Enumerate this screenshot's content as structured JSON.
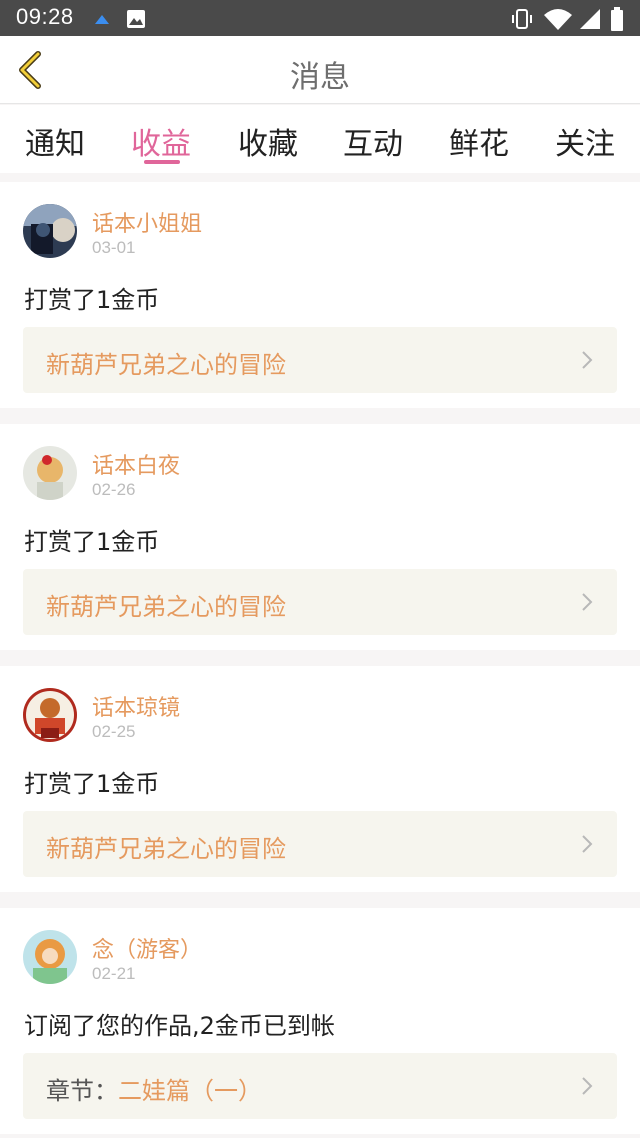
{
  "status_bar": {
    "time": "09:28"
  },
  "header": {
    "title": "消息"
  },
  "tabs": [
    {
      "label": "通知"
    },
    {
      "label": "收益"
    },
    {
      "label": "收藏"
    },
    {
      "label": "互动"
    },
    {
      "label": "鲜花"
    },
    {
      "label": "关注"
    }
  ],
  "active_tab": "收益",
  "messages": [
    {
      "name": "话本小姐姐",
      "date": "03-01",
      "text": "打赏了1金币",
      "work": "新葫芦兄弟之心的冒险"
    },
    {
      "name": "话本白夜",
      "date": "02-26",
      "text": "打赏了1金币",
      "work": "新葫芦兄弟之心的冒险"
    },
    {
      "name": "话本琼镜",
      "date": "02-25",
      "text": "打赏了1金币",
      "work": "新葫芦兄弟之心的冒险"
    },
    {
      "name": "念（游客）",
      "date": "02-21",
      "text": "订阅了您的作品,2金币已到帐",
      "work_prefix": "章节：",
      "work": "二娃篇（一）"
    }
  ],
  "colors": {
    "accent_pink": "#e0669a",
    "accent_orange": "#e59a5f",
    "status_bar": "#4a4a4a"
  }
}
